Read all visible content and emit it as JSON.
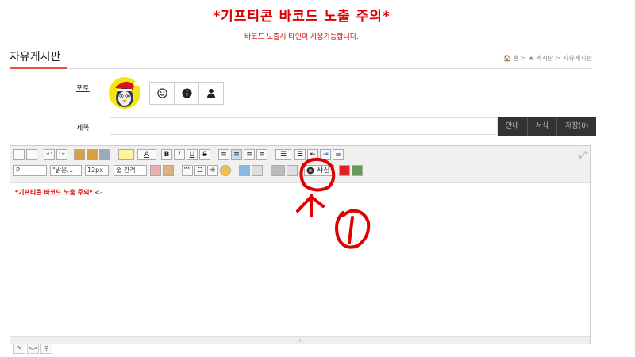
{
  "banner": {
    "title": "*기프티콘 바코드 노출 주의*",
    "subtitle": "바코드 노출시 타인이 사용가능합니다."
  },
  "board": {
    "title": "자유게시판",
    "breadcrumb": "🏠 홈 > ★ 게시판 > 자유게시판"
  },
  "form": {
    "photo_label": "포토",
    "subject_label": "제목",
    "subject_value": "",
    "subject_buttons": [
      "안내",
      "서식",
      "저장(0)"
    ],
    "icon_buttons": [
      "smile-icon",
      "info-icon",
      "user-icon"
    ]
  },
  "toolbar": {
    "format": "P",
    "font": "\"맑은...",
    "size": "12px",
    "line_height": "줄 간격",
    "photo_label": "사진",
    "bold": "B",
    "italic": "I",
    "underline": "U",
    "strike": "S",
    "quote": "““",
    "omega": "Ω",
    "text_color": "A"
  },
  "editor": {
    "content_red": "*기프티콘 바코드 노출 주의*",
    "content_tail": " <-"
  },
  "annotation": {
    "label": "1",
    "color": "#e00000"
  },
  "colors": {
    "accent": "#e8503a",
    "warning": "#dd0000"
  }
}
